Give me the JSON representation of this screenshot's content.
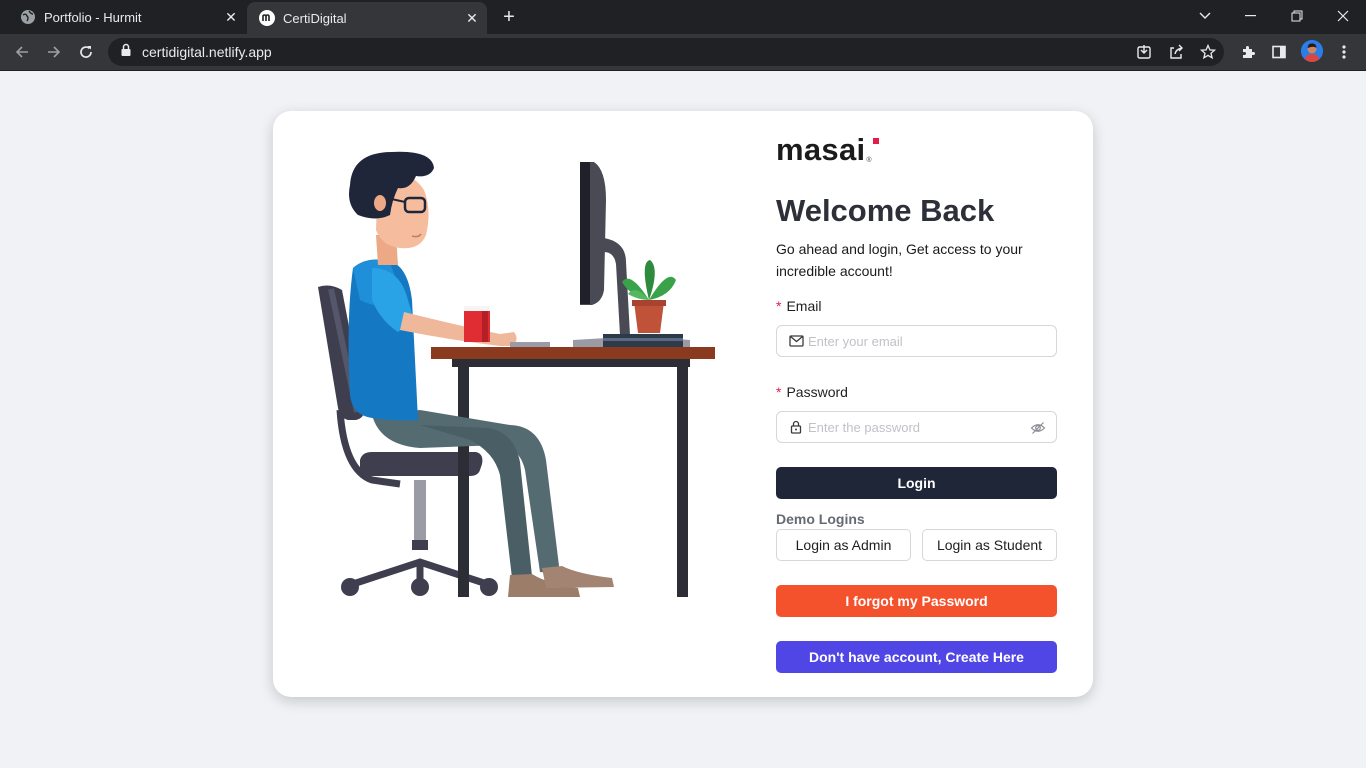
{
  "browser": {
    "tabs": [
      {
        "title": "Portfolio - Hurmit",
        "favicon": "globe-icon",
        "active": false
      },
      {
        "title": "CertiDigital",
        "favicon": "masai-m-icon",
        "active": true
      }
    ],
    "url": "certidigital.netlify.app"
  },
  "logo": {
    "text": "masai",
    "mark": "®",
    "dot_color": "#e11d48"
  },
  "login": {
    "heading": "Welcome Back",
    "subheading": "Go ahead and login, Get access to your incredible account!",
    "email_label": "Email",
    "email_placeholder": "Enter your email",
    "password_label": "Password",
    "password_placeholder": "Enter the password",
    "required_mark": "*",
    "login_button": "Login",
    "demo_title": "Demo Logins",
    "demo_admin": "Login as Admin",
    "demo_student": "Login as Student",
    "forgot_button": "I forgot my Password",
    "create_button": "Don't have account, Create Here"
  },
  "colors": {
    "login_button": "#1e2637",
    "forgot_button": "#f4522d",
    "create_button": "#4f46e5",
    "page_background": "#f0f2f5"
  }
}
